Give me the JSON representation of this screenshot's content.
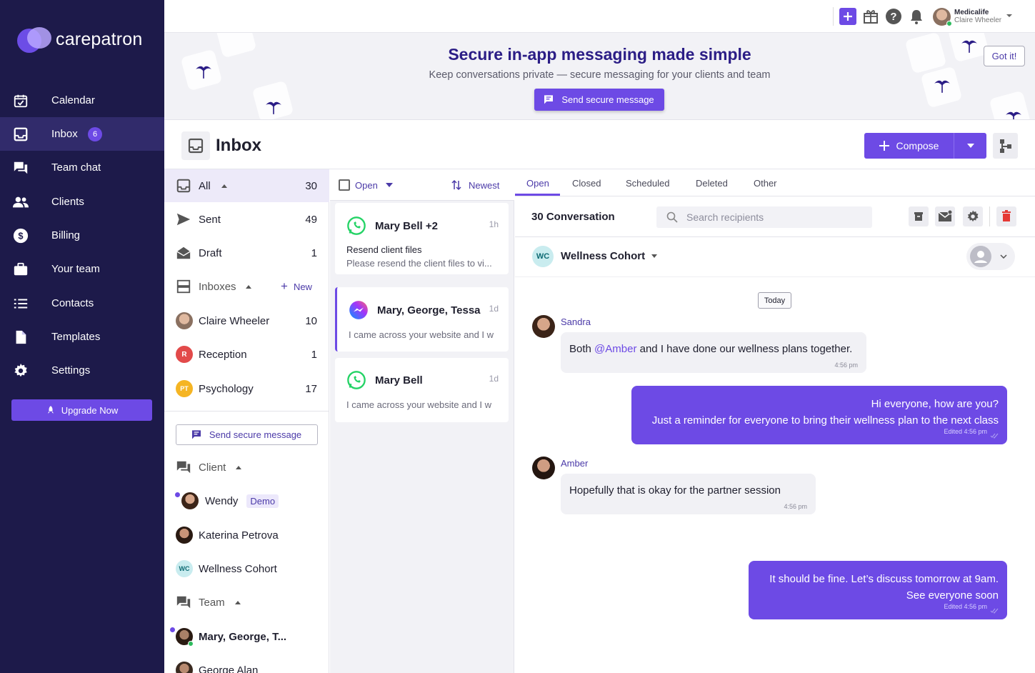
{
  "brand": {
    "name": "carepatron",
    "accent": "#6d4ae5",
    "sidebar_bg": "#1d1a4a"
  },
  "sidebar": {
    "items": [
      {
        "label": "Calendar",
        "icon": "calendar-icon"
      },
      {
        "label": "Inbox",
        "icon": "inbox-icon",
        "badge": "6"
      },
      {
        "label": "Team chat",
        "icon": "chat-icon"
      },
      {
        "label": "Clients",
        "icon": "clients-icon"
      },
      {
        "label": "Billing",
        "icon": "billing-icon"
      },
      {
        "label": "Your team",
        "icon": "briefcase-icon"
      },
      {
        "label": "Contacts",
        "icon": "list-icon"
      },
      {
        "label": "Templates",
        "icon": "document-icon"
      },
      {
        "label": "Settings",
        "icon": "gear-icon"
      }
    ],
    "upgrade_label": "Upgrade Now"
  },
  "topbar": {
    "workspace": "Medicalife",
    "user": "Claire Wheeler"
  },
  "banner": {
    "title": "Secure in-app messaging made simple",
    "subtitle": "Keep conversations private — secure messaging for your clients and team",
    "cta": "Send secure message",
    "dismiss": "Got it!"
  },
  "page": {
    "title": "Inbox",
    "compose_label": "Compose"
  },
  "folders": {
    "all": {
      "label": "All",
      "count": "30"
    },
    "sent": {
      "label": "Sent",
      "count": "49"
    },
    "draft": {
      "label": "Draft",
      "count": "1"
    },
    "inboxes_label": "Inboxes",
    "new_label": "New",
    "inboxes": [
      {
        "label": "Claire Wheeler",
        "count": "10"
      },
      {
        "label": "Reception",
        "count": "1",
        "initials": "R"
      },
      {
        "label": "Psychology",
        "count": "17",
        "initials": "PT"
      }
    ],
    "send_secure": "Send secure message",
    "client_label": "Client",
    "clients": [
      {
        "label": "Wendy",
        "tag": "Demo"
      },
      {
        "label": "Katerina Petrova"
      },
      {
        "label": "Wellness Cohort",
        "initials": "WC"
      }
    ],
    "team_label": "Team",
    "team": [
      {
        "label": "Mary, George, T..."
      },
      {
        "label": "George Alan"
      }
    ]
  },
  "threads": {
    "filter": "Open",
    "sort": "Newest",
    "items": [
      {
        "name": "Mary Bell  +2",
        "time": "1h",
        "subject": "Resend client files",
        "preview": "Please resend the client files to vi...",
        "channel": "whatsapp-icon"
      },
      {
        "name": "Mary, George, Tessa",
        "time": "1d",
        "preview": "I came across your website and I w",
        "channel": "messenger-icon"
      },
      {
        "name": "Mary Bell",
        "time": "1d",
        "preview": "I came across your website and I w",
        "channel": "whatsapp-icon"
      }
    ]
  },
  "conversation": {
    "tabs": [
      "Open",
      "Closed",
      "Scheduled",
      "Deleted",
      "Other"
    ],
    "count_label": "30 Conversation",
    "search_placeholder": "Search recipients",
    "group_initials": "WC",
    "group_name": "Wellness Cohort",
    "day_label": "Today",
    "messages": [
      {
        "sender": "Sandra",
        "pre": "Both ",
        "mention": "@Amber",
        "post": " and I have done our wellness plans together.",
        "time": "4:56 pm"
      },
      {
        "line1": "Hi everyone, how are you?",
        "line2": "Just a reminder for everyone to bring their wellness plan to the next class",
        "meta": "Edited  4:56 pm"
      },
      {
        "sender": "Amber",
        "text": "Hopefully that is okay for the partner session",
        "time": "4:56 pm"
      },
      {
        "line1": "It should be fine. Let’s discuss tomorrow at 9am.",
        "line2": "See everyone soon",
        "meta": "Edited  4:56 pm"
      }
    ]
  }
}
